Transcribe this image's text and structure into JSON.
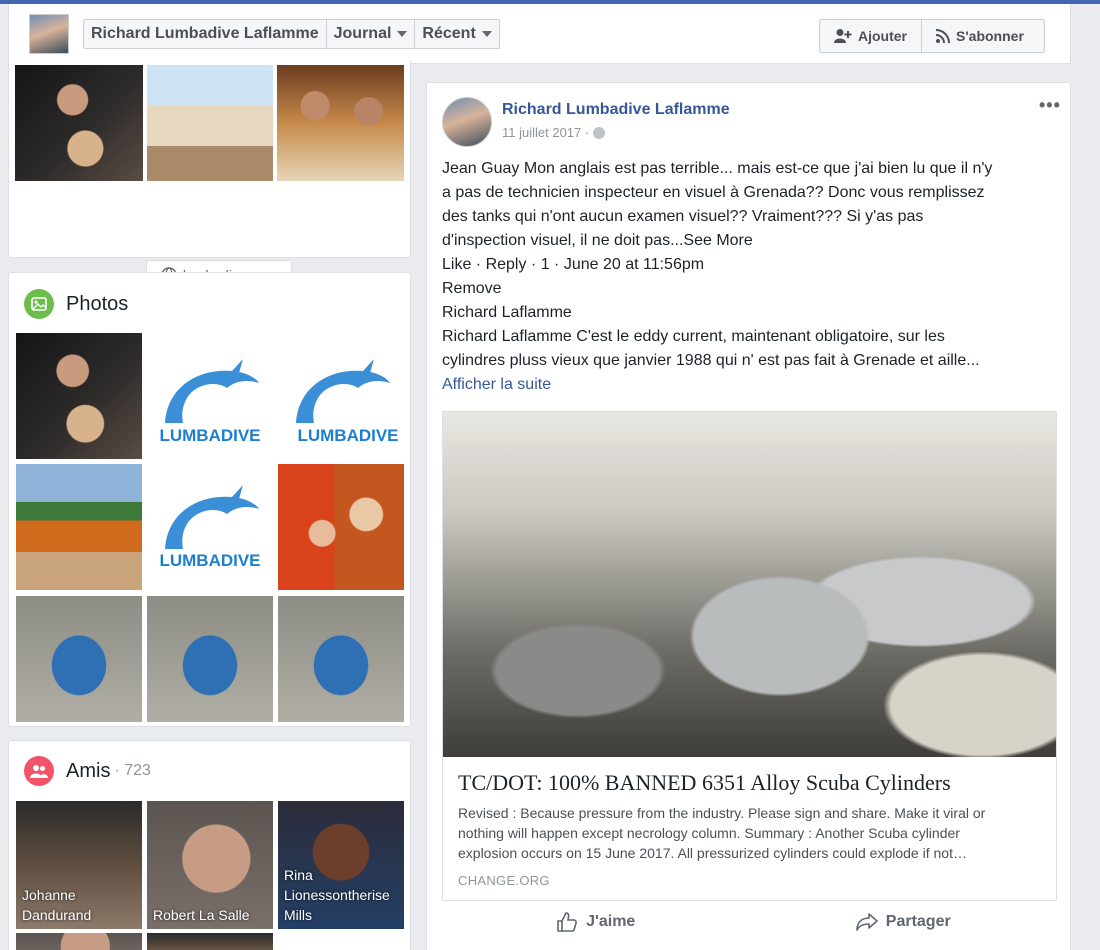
{
  "header": {
    "name": "Richard Lumbadive Laflamme",
    "journal": "Journal",
    "recent": "Récent",
    "add_label": "Ajouter",
    "subscribe_label": "S'abonner"
  },
  "intro": {
    "website": "lumbadive.com"
  },
  "photos": {
    "title": "Photos",
    "logo_text": "LUMBADIVE"
  },
  "friends": {
    "title": "Amis",
    "count": "· 723",
    "items": [
      {
        "name_line1": "Johanne",
        "name_line2": "Dandurand",
        "name_line3": ""
      },
      {
        "name_line1": "Robert La Salle",
        "name_line2": "",
        "name_line3": ""
      },
      {
        "name_line1": "Rina",
        "name_line2": "Lionessontherise",
        "name_line3": "Mills"
      }
    ]
  },
  "post": {
    "author": "Richard Lumbadive Laflamme",
    "date": "11 juillet 2017 ·",
    "menu": "•••",
    "lines": [
      "Jean Guay Mon anglais est pas terrible... mais est-ce que j'ai bien lu que il n'y",
      "a pas de technicien inspecteur en visuel à Grenada?? Donc vous remplissez",
      "des tanks qui n'ont aucun examen visuel?? Vraiment??? Si y'as pas",
      "d'inspection visuel, il ne doit pas...See More",
      "Like · Reply · 1 · June 20 at 11:56pm",
      "Remove",
      "Richard Laflamme",
      "Richard Laflamme C'est le eddy current, maintenant obligatoire, sur les",
      "cylindres pluss vieux que janvier 1988 qui n' est pas fait à Grenade et aille..."
    ],
    "see_more": "Afficher la suite",
    "link": {
      "title": "TC/DOT: 100% BANNED 6351 Alloy Scuba Cylinders",
      "desc_line1": "Revised : Because pressure from the industry. Please sign and share. Make it viral or",
      "desc_line2": "nothing will happen except necrology column. Summary : Another Scuba cylinder",
      "desc_line3": "explosion occurs on 15 June 2017. All pressurized cylinders could explode if not…",
      "source": "CHANGE.ORG"
    },
    "like_label": "J'aime",
    "share_label": "Partager"
  }
}
